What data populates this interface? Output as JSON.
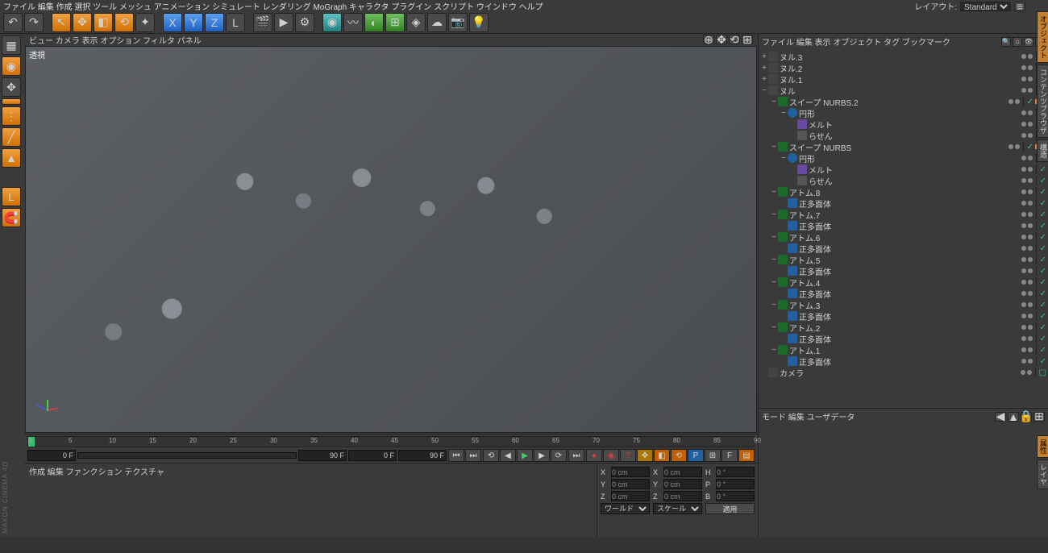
{
  "menus": [
    "ファイル",
    "編集",
    "作成",
    "選択",
    "ツール",
    "メッシュ",
    "アニメーション",
    "シミュレート",
    "レンダリング",
    "MoGraph",
    "キャラクタ",
    "プラグイン",
    "スクリプト",
    "ウインドウ",
    "ヘルプ"
  ],
  "layout_label": "レイアウト:",
  "layout_value": "Standard",
  "view_menus": [
    "ビュー",
    "カメラ",
    "表示",
    "オプション",
    "フィルタ",
    "パネル"
  ],
  "viewport_label": "透視",
  "timeline": {
    "start": 0,
    "end": 90,
    "fields": [
      "0 F",
      "90 F",
      "0 F",
      "90 F"
    ]
  },
  "lower_tabs": [
    "作成",
    "編集",
    "ファンクション",
    "テクスチャ"
  ],
  "coords": {
    "rows": [
      {
        "l": "X",
        "v": "0 cm",
        "l2": "X",
        "v2": "0 cm",
        "l3": "H",
        "v3": "0 °"
      },
      {
        "l": "Y",
        "v": "0 cm",
        "l2": "Y",
        "v2": "0 cm",
        "l3": "P",
        "v3": "0 °"
      },
      {
        "l": "Z",
        "v": "0 cm",
        "l2": "Z",
        "v2": "0 cm",
        "l3": "B",
        "v3": "0 °"
      }
    ],
    "sel1": "ワールド",
    "sel2": "スケール",
    "apply": "適用"
  },
  "om_menus": [
    "ファイル",
    "編集",
    "表示",
    "オブジェクト",
    "タグ",
    "ブックマーク"
  ],
  "tree": [
    {
      "d": 0,
      "exp": "+",
      "ico": "null",
      "name": "ヌル.3",
      "tags": [
        "dot",
        "dot",
        "sep",
        "chk"
      ]
    },
    {
      "d": 0,
      "exp": "+",
      "ico": "null",
      "name": "ヌル.2",
      "tags": [
        "dot",
        "dot",
        "sep",
        "chk"
      ]
    },
    {
      "d": 0,
      "exp": "+",
      "ico": "null",
      "name": "ヌル.1",
      "tags": [
        "dot",
        "dot",
        "sep",
        "chk"
      ]
    },
    {
      "d": 0,
      "exp": "−",
      "ico": "null",
      "name": "ヌル",
      "tags": [
        "dot",
        "dot",
        "sep",
        "chk"
      ]
    },
    {
      "d": 1,
      "exp": "−",
      "ico": "sweep",
      "name": "スイープ NURBS.2",
      "tags": [
        "dot",
        "dot",
        "sep",
        "chk",
        "orange",
        "orange"
      ]
    },
    {
      "d": 2,
      "exp": "−",
      "ico": "circle",
      "name": "円形",
      "tags": [
        "dot",
        "dot",
        "sep",
        "chk"
      ]
    },
    {
      "d": 3,
      "exp": "",
      "ico": "melt",
      "name": "メルト",
      "tags": [
        "dot",
        "dot",
        "sep",
        "chk"
      ]
    },
    {
      "d": 3,
      "exp": "",
      "ico": "helix",
      "name": "らせん",
      "tags": [
        "dot",
        "dot",
        "sep",
        "chk"
      ]
    },
    {
      "d": 1,
      "exp": "−",
      "ico": "sweep",
      "name": "スイープ NURBS",
      "tags": [
        "dot",
        "dot",
        "sep",
        "chk",
        "orange",
        "orange"
      ]
    },
    {
      "d": 2,
      "exp": "−",
      "ico": "circle",
      "name": "円形",
      "tags": [
        "dot",
        "dot",
        "sep",
        "chk"
      ]
    },
    {
      "d": 3,
      "exp": "",
      "ico": "melt",
      "name": "メルト",
      "tags": [
        "dot",
        "dot",
        "sep",
        "chk"
      ]
    },
    {
      "d": 3,
      "exp": "",
      "ico": "helix",
      "name": "らせん",
      "tags": [
        "dot",
        "dot",
        "sep",
        "chk"
      ]
    },
    {
      "d": 1,
      "exp": "−",
      "ico": "atom",
      "name": "アトム.8",
      "tags": [
        "dot",
        "dot",
        "sep",
        "chk"
      ]
    },
    {
      "d": 2,
      "exp": "",
      "ico": "platon",
      "name": "正多面体",
      "tags": [
        "dot",
        "dot",
        "sep",
        "chk"
      ]
    },
    {
      "d": 1,
      "exp": "−",
      "ico": "atom",
      "name": "アトム.7",
      "tags": [
        "dot",
        "dot",
        "sep",
        "chk"
      ]
    },
    {
      "d": 2,
      "exp": "",
      "ico": "platon",
      "name": "正多面体",
      "tags": [
        "dot",
        "dot",
        "sep",
        "chk"
      ]
    },
    {
      "d": 1,
      "exp": "−",
      "ico": "atom",
      "name": "アトム.6",
      "tags": [
        "dot",
        "dot",
        "sep",
        "chk"
      ]
    },
    {
      "d": 2,
      "exp": "",
      "ico": "platon",
      "name": "正多面体",
      "tags": [
        "dot",
        "dot",
        "sep",
        "chk"
      ]
    },
    {
      "d": 1,
      "exp": "−",
      "ico": "atom",
      "name": "アトム.5",
      "tags": [
        "dot",
        "dot",
        "sep",
        "chk"
      ]
    },
    {
      "d": 2,
      "exp": "",
      "ico": "platon",
      "name": "正多面体",
      "tags": [
        "dot",
        "dot",
        "sep",
        "chk"
      ]
    },
    {
      "d": 1,
      "exp": "−",
      "ico": "atom",
      "name": "アトム.4",
      "tags": [
        "dot",
        "dot",
        "sep",
        "chk"
      ]
    },
    {
      "d": 2,
      "exp": "",
      "ico": "platon",
      "name": "正多面体",
      "tags": [
        "dot",
        "dot",
        "sep",
        "chk"
      ]
    },
    {
      "d": 1,
      "exp": "−",
      "ico": "atom",
      "name": "アトム.3",
      "tags": [
        "dot",
        "dot",
        "sep",
        "chk"
      ]
    },
    {
      "d": 2,
      "exp": "",
      "ico": "platon",
      "name": "正多面体",
      "tags": [
        "dot",
        "dot",
        "sep",
        "chk"
      ]
    },
    {
      "d": 1,
      "exp": "−",
      "ico": "atom",
      "name": "アトム.2",
      "tags": [
        "dot",
        "dot",
        "sep",
        "chk"
      ]
    },
    {
      "d": 2,
      "exp": "",
      "ico": "platon",
      "name": "正多面体",
      "tags": [
        "dot",
        "dot",
        "sep",
        "chk"
      ]
    },
    {
      "d": 1,
      "exp": "−",
      "ico": "atom",
      "name": "アトム.1",
      "tags": [
        "dot",
        "dot",
        "sep",
        "chk"
      ]
    },
    {
      "d": 2,
      "exp": "",
      "ico": "platon",
      "name": "正多面体",
      "tags": [
        "dot",
        "dot",
        "sep",
        "chk"
      ]
    },
    {
      "d": 0,
      "exp": "",
      "ico": "camera",
      "name": "カメラ",
      "tags": [
        "dot",
        "dot",
        "sep",
        "box"
      ]
    }
  ],
  "attr_menus": [
    "モード",
    "編集",
    "ユーザデータ"
  ],
  "side_tabs": [
    "オブジェクト",
    "コンテンツブラウザ",
    "構造"
  ],
  "side_tabs2": [
    "属性",
    "レイヤ"
  ],
  "brand": "MAXON CINEMA 4D"
}
